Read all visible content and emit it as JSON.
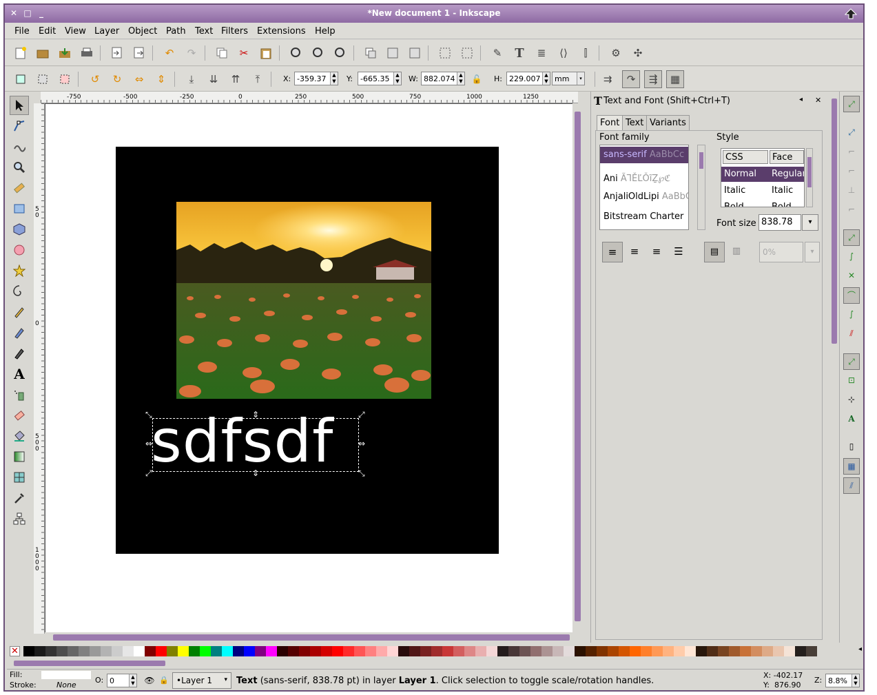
{
  "window": {
    "title": "*New document 1 - Inkscape"
  },
  "menu": [
    "File",
    "Edit",
    "View",
    "Layer",
    "Object",
    "Path",
    "Text",
    "Filters",
    "Extensions",
    "Help"
  ],
  "toolcontrols": {
    "x_label": "X:",
    "x_value": "-359.37",
    "y_label": "Y:",
    "y_value": "-665.35",
    "w_label": "W:",
    "w_value": "882.074",
    "h_label": "H:",
    "h_value": "229.007",
    "unit": "mm"
  },
  "ruler": {
    "top_ticks": [
      "-750",
      "-500",
      "-250",
      "0",
      "250",
      "500",
      "750",
      "1000",
      "1250"
    ],
    "left_ticks": [
      "5\n0",
      "0",
      "5\n0\n0",
      "1\n0\n0\n0"
    ]
  },
  "canvas": {
    "text": "sdfsdf"
  },
  "dock": {
    "title": "Text and Font (Shift+Ctrl+T)",
    "tabs": [
      "Font",
      "Text",
      "Variants"
    ],
    "font_family_label": "Font family",
    "style_label": "Style",
    "families": [
      {
        "name": "sans-serif",
        "sample": "AaBbCc"
      },
      {
        "name": "Ani",
        "sample": "ÃꞀĚĽǑĩẔ℘ℭ"
      },
      {
        "name": "AnjaliOldLipi",
        "sample": "AaBbC"
      },
      {
        "name": "Bitstream Charter",
        "sample": ""
      }
    ],
    "style_headers": [
      "CSS",
      "Face"
    ],
    "styles": [
      {
        "css": "Normal",
        "face": "Regular"
      },
      {
        "css": "Italic",
        "face": "Italic"
      },
      {
        "css": "Bold",
        "face": "Bold"
      }
    ],
    "font_size_label": "Font size",
    "font_size": "838.78",
    "spacing_value": "0%"
  },
  "status": {
    "fill_label": "Fill:",
    "stroke_label": "Stroke:",
    "stroke_value": "None",
    "opacity_label": "O:",
    "opacity_value": "0",
    "layer": "•Layer 1",
    "message_bold": "Text",
    "message": " (sans-serif, 838.78 pt) in layer ",
    "message_layer": "Layer 1",
    "message_end": ". Click selection to toggle scale/rotation handles.",
    "x_coord": "X: -402.17",
    "y_coord": "Y:  876.90",
    "zoom_label": "Z:",
    "zoom": "8.8%"
  },
  "colors": {
    "accent": "#8e6aa3",
    "selection": "#5a3d6b"
  }
}
